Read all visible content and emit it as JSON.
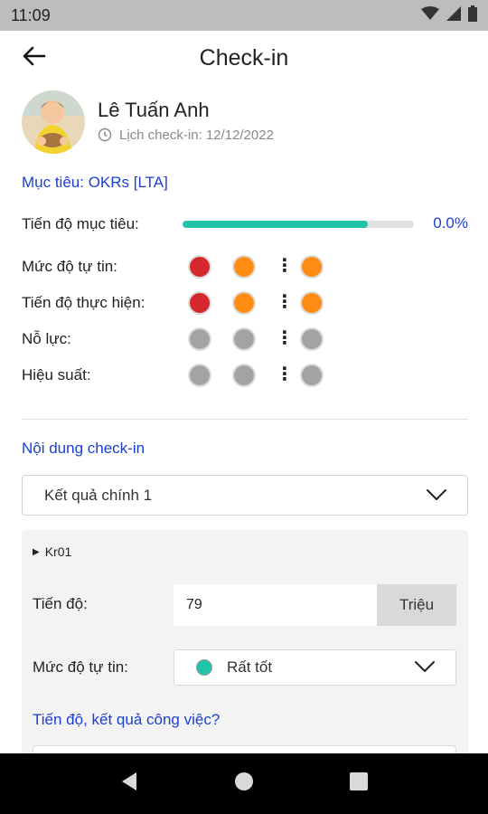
{
  "status_bar": {
    "time": "11:09"
  },
  "header": {
    "title": "Check-in"
  },
  "profile": {
    "name": "Lê Tuấn Anh",
    "schedule": "Lịch check-in: 12/12/2022"
  },
  "goal": {
    "title": "Mục tiêu: OKRs [LTA]",
    "progress_label": "Tiến độ mục tiêu:",
    "progress_percent_text": "0.0%",
    "progress_fill_fraction": 0.8
  },
  "metrics": [
    {
      "label": "Mức độ tự tin:",
      "dots": [
        "red",
        "orange",
        "orange"
      ]
    },
    {
      "label": "Tiến độ thực hiện:",
      "dots": [
        "red",
        "orange",
        "orange"
      ]
    },
    {
      "label": "Nỗ lực:",
      "dots": [
        "grey",
        "grey",
        "grey"
      ]
    },
    {
      "label": "Hiệu suất:",
      "dots": [
        "grey",
        "grey",
        "grey"
      ]
    }
  ],
  "content": {
    "title": "Nội dung check-in",
    "selected_kr": "Kết quả chính 1"
  },
  "kr_card": {
    "code": "Kr01",
    "progress_label": "Tiến độ:",
    "progress_value": "79",
    "unit": "Triệu",
    "confidence_label": "Mức độ tự tin:",
    "confidence_value": "Rất tốt",
    "confidence_color": "#21c4a8",
    "work_question": "Tiến độ, kết quả công việc?"
  },
  "colors": {
    "accent_blue": "#1a3fd1",
    "teal": "#21c4a8",
    "red": "#d4282c",
    "orange": "#ff8d14",
    "grey": "#a3a3a3"
  }
}
